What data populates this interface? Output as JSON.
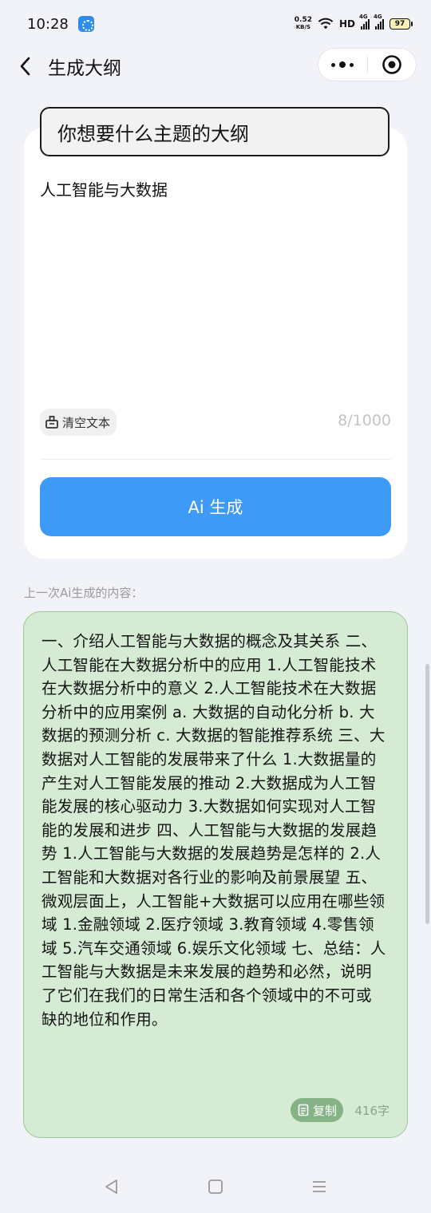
{
  "status_bar": {
    "time": "10:28",
    "net_speed": "0.52",
    "net_unit": "KB/S",
    "hd": "HD",
    "signal1": "4G",
    "signal2": "4G",
    "battery": "97"
  },
  "header": {
    "title": "生成大纲",
    "back_icon": "chevron-left-icon",
    "more_icon": "more-dots-icon",
    "target_icon": "target-icon"
  },
  "input_card": {
    "topic_label": "你想要什么主题的大纲",
    "topic_value": "人工智能与大数据",
    "clear_label": "清空文本",
    "char_count": "8/1000",
    "generate_label": "Ai 生成"
  },
  "previous": {
    "label": "上一次Ai生成的内容：",
    "content": "一、介绍人工智能与大数据的概念及其关系 二、人工智能在大数据分析中的应用 1.人工智能技术在大数据分析中的意义 2.人工智能技术在大数据分析中的应用案例 a. 大数据的自动化分析 b. 大数据的预测分析 c. 大数据的智能推荐系统 三、大数据对人工智能的发展带来了什么 1.大数据量的产生对人工智能发展的推动 2.大数据成为人工智能发展的核心驱动力 3.大数据如何实现对人工智能的发展和进步 四、人工智能与大数据的发展趋势 1.人工智能与大数据的发展趋势是怎样的 2.人工智能和大数据对各行业的影响及前景展望 五、微观层面上，人工智能+大数据可以应用在哪些领域 1.金融领域 2.医疗领域 3.教育领域 4.零售领域 5.汽车交通领域 6.娱乐文化领域 七、总结：人工智能与大数据是未来发展的趋势和必然，说明了它们在我们的日常生活和各个领域中的不可或缺的地位和作用。",
    "copy_label": "复制",
    "char_count": "416字"
  },
  "colors": {
    "accent": "#3d9bf7",
    "result_bg": "#d5ebd4",
    "result_border": "#9dc59c",
    "copy_bg": "#86b385"
  }
}
